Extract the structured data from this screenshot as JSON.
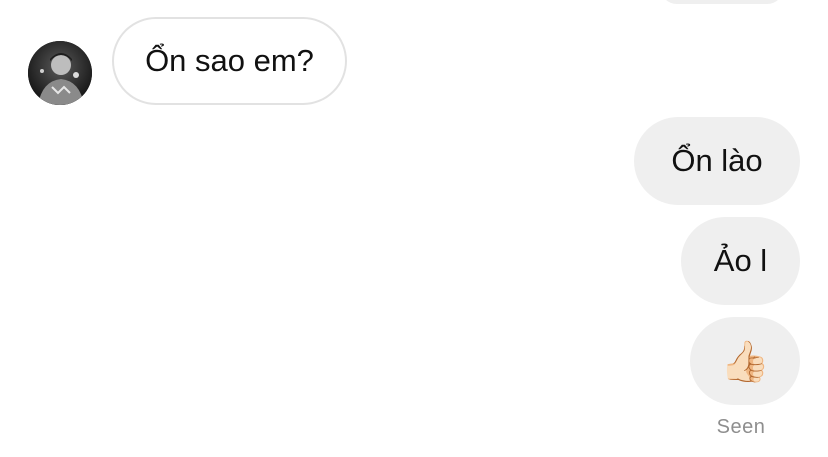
{
  "thread": {
    "incoming_messages": [
      {
        "text": "Ổn sao em?"
      }
    ],
    "outgoing_messages": [
      {
        "text": "Ổn lào"
      },
      {
        "text": "Ảo l"
      },
      {
        "text": "👍🏻"
      }
    ],
    "seen_label": "Seen",
    "avatar_icon": "profile-photo-icon"
  },
  "colors": {
    "outgoing_bubble": "#efefef",
    "incoming_border": "#e2e2e2",
    "seen_text": "#8e8e8e"
  }
}
